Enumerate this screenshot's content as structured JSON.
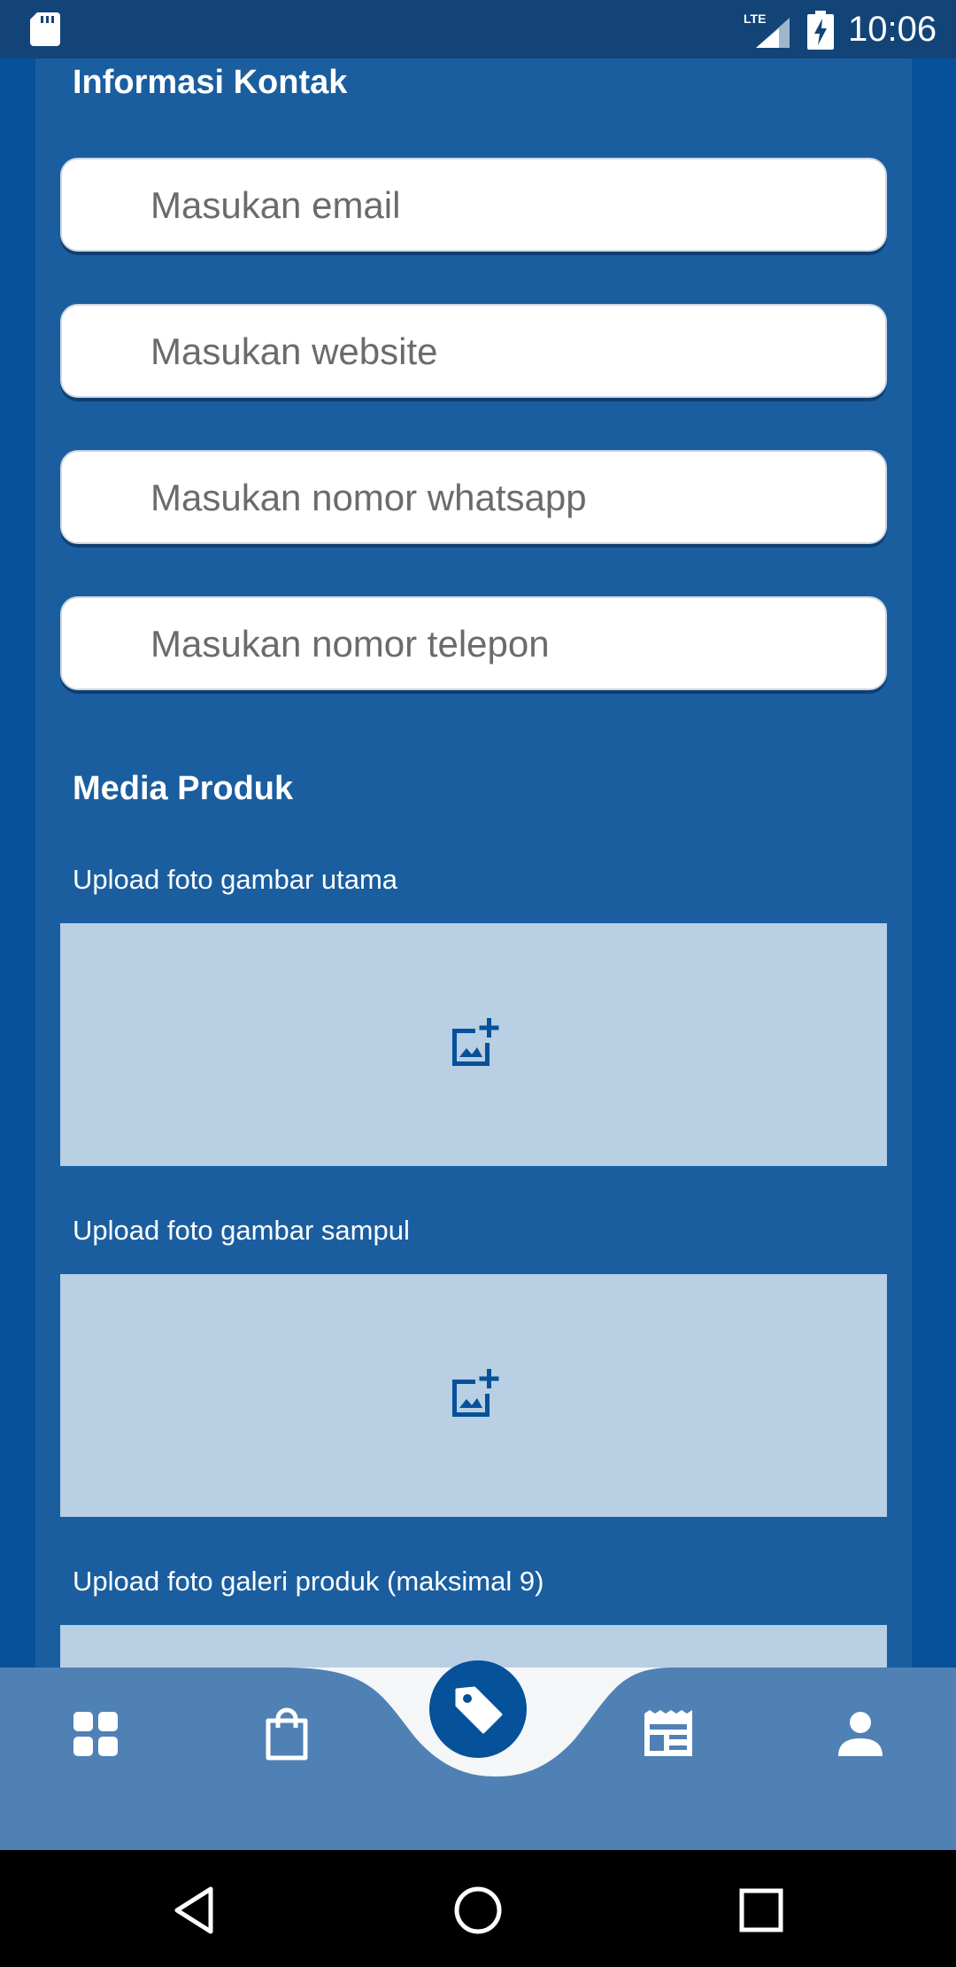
{
  "status_bar": {
    "time": "10:06",
    "network": "LTE",
    "icons": [
      "sd-card-icon",
      "lte-signal-icon",
      "battery-charging-icon"
    ]
  },
  "contact_section": {
    "title": "Informasi Kontak",
    "fields": [
      {
        "placeholder": "Masukan email",
        "value": ""
      },
      {
        "placeholder": "Masukan website",
        "value": ""
      },
      {
        "placeholder": "Masukan nomor whatsapp",
        "value": ""
      },
      {
        "placeholder": "Masukan nomor telepon",
        "value": ""
      }
    ]
  },
  "media_section": {
    "title": "Media Produk",
    "uploads": [
      {
        "label": "Upload foto gambar utama",
        "icon": "add-photo-icon"
      },
      {
        "label": "Upload foto gambar sampul",
        "icon": "add-photo-icon"
      },
      {
        "label": "Upload foto galeri produk (maksimal 9)",
        "icon": "add-photo-icon"
      }
    ]
  },
  "bottom_nav": {
    "items": [
      {
        "icon": "dashboard-grid-icon"
      },
      {
        "icon": "shopping-bag-icon"
      },
      {
        "icon": "tag-icon",
        "active": true
      },
      {
        "icon": "newspaper-icon"
      },
      {
        "icon": "person-icon"
      }
    ]
  },
  "colors": {
    "background": "#05519A",
    "panel": "#1A5E9F",
    "upload_box": "#B8CFE4",
    "bottom_nav": "#4F81B4",
    "status_bar": "#124478"
  }
}
